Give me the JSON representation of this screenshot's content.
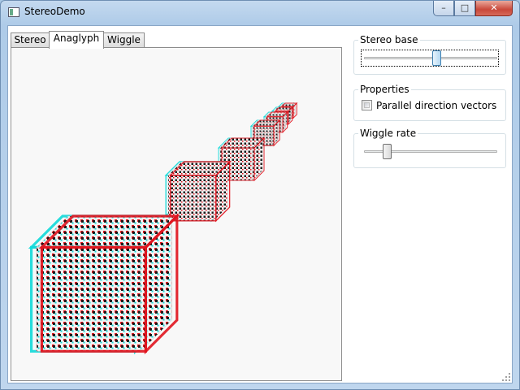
{
  "window": {
    "title": "StereoDemo",
    "controls": {
      "minimize": "–",
      "maximize": "□",
      "close": "✕"
    }
  },
  "tabs": [
    {
      "label": "Stereo",
      "selected": false
    },
    {
      "label": "Anaglyph",
      "selected": true
    },
    {
      "label": "Wiggle",
      "selected": false
    }
  ],
  "scene": {
    "description_colors": {
      "red": "#e0141e",
      "cyan": "#10d8d8",
      "dark": "#1a1a1a"
    },
    "cube_count": 7
  },
  "stereo_base": {
    "header": "Stereo base",
    "value": 0.55
  },
  "properties": {
    "header": "Properties",
    "parallel_label": "Parallel direction vectors",
    "parallel_checked": false
  },
  "wiggle_rate": {
    "header": "Wiggle rate",
    "value": 0.15
  },
  "colors": {
    "accent": "#3c7fb1",
    "group_border": "#d5dfe5"
  }
}
